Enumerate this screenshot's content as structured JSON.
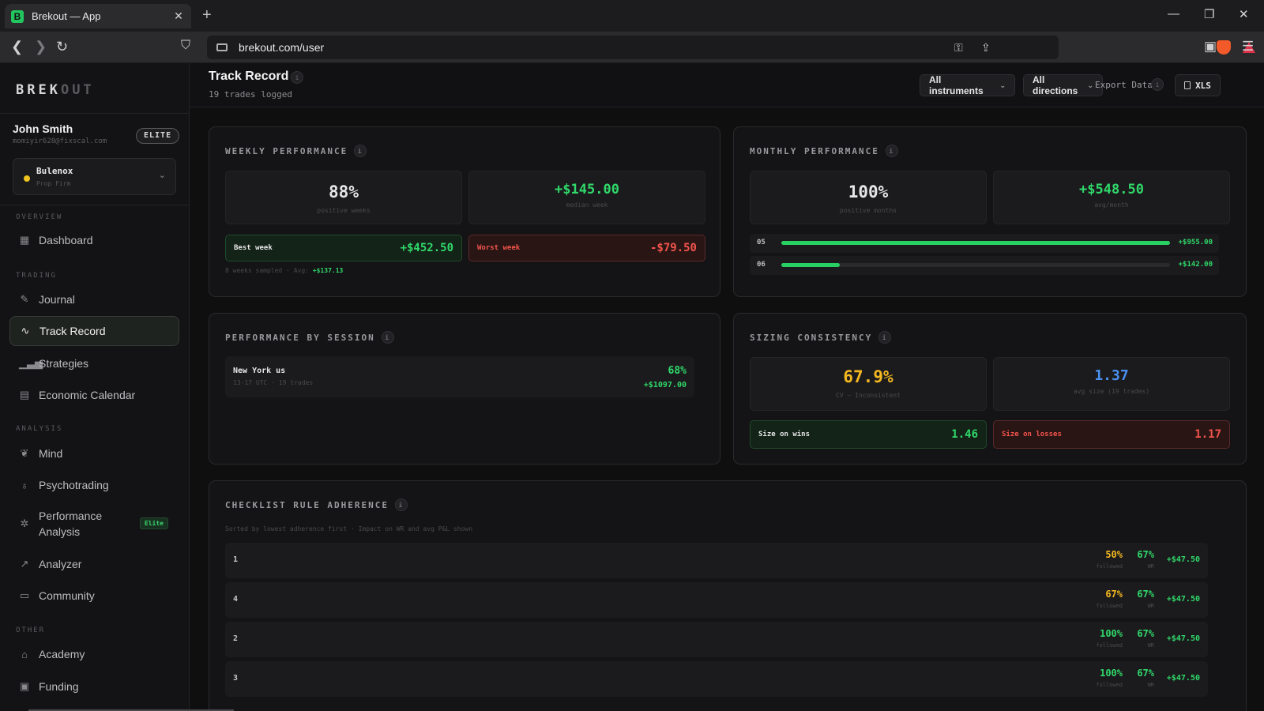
{
  "browser": {
    "tab_title": "Brekout — App",
    "tab_favicon": "B",
    "url": "brekout.com/user"
  },
  "sidebar": {
    "logo_bright": "BREK",
    "logo_dim": "OUT",
    "user": {
      "name": "John Smith",
      "email": "momiyir628@fixscal.com",
      "badge": "ELITE"
    },
    "firm": {
      "name": "Bulenox",
      "type": "Prop Firm",
      "status_color": "#f0c420"
    },
    "sections": {
      "overview": "OVERVIEW",
      "trading": "TRADING",
      "analysis": "ANALYSIS",
      "other": "OTHER"
    },
    "items": {
      "dashboard": {
        "label": "Dashboard",
        "icon": "grid-icon"
      },
      "journal": {
        "label": "Journal",
        "icon": "pencil-icon"
      },
      "track_record": {
        "label": "Track Record",
        "icon": "activity-icon",
        "active": true
      },
      "strategies": {
        "label": "Strategies",
        "icon": "bars-icon"
      },
      "economic_calendar": {
        "label": "Economic Calendar",
        "icon": "calendar-icon"
      },
      "mind": {
        "label": "Mind",
        "icon": "brain-icon"
      },
      "psychotrading": {
        "label": "Psychotrading",
        "icon": "bulb-icon"
      },
      "performance_analysis": {
        "label": "Performance Analysis",
        "icon": "sun-icon",
        "badge": "Elite"
      },
      "analyzer": {
        "label": "Analyzer",
        "icon": "trend-icon"
      },
      "community": {
        "label": "Community",
        "icon": "chat-icon"
      },
      "academy": {
        "label": "Academy",
        "icon": "cap-icon"
      },
      "funding": {
        "label": "Funding",
        "icon": "briefcase-icon"
      }
    }
  },
  "header": {
    "title": "Track Record",
    "subtitle": "19 trades logged",
    "filter_instruments": "All instruments",
    "filter_directions": "All directions",
    "export_label": "Export Data",
    "xls_label": "XLS"
  },
  "weekly": {
    "title": "WEEKLY PERFORMANCE",
    "positive_value": "88%",
    "positive_label": "positive weeks",
    "median_value": "+$145.00",
    "median_label": "median week",
    "best_label": "Best week",
    "best_value": "+$452.50",
    "worst_label": "Worst week",
    "worst_value": "-$79.50",
    "footer_text": "8 weeks sampled · Avg:",
    "footer_avg": "+$137.13"
  },
  "monthly": {
    "title": "MONTHLY PERFORMANCE",
    "positive_value": "100%",
    "positive_label": "positive months",
    "avg_value": "+$548.50",
    "avg_label": "avg/month",
    "rows": [
      {
        "month": "05",
        "value": "+$955.00",
        "fill_fraction": 1.0
      },
      {
        "month": "06",
        "value": "+$142.00",
        "fill_fraction": 0.15
      }
    ]
  },
  "session": {
    "title": "PERFORMANCE BY SESSION",
    "name": "New York us",
    "sub": "13-17 UTC · 19 trades",
    "winrate": "68%",
    "pnl": "+$1097.00"
  },
  "sizing": {
    "title": "SIZING CONSISTENCY",
    "cv_value": "67.9%",
    "cv_label": "CV — Inconsistent",
    "avg_value": "1.37",
    "avg_label": "avg size (19 trades)",
    "wins_label": "Size on wins",
    "wins_value": "1.46",
    "losses_label": "Size on losses",
    "losses_value": "1.17"
  },
  "checklist": {
    "title": "CHECKLIST RULE ADHERENCE",
    "subtitle": "Sorted by lowest adherence first · Impact on WR and avg P&L shown",
    "followed_label": "followed",
    "wr_label": "WR",
    "rows": [
      {
        "id": "1",
        "followed": "50%",
        "followed_color": "#f5b820",
        "wr": "67%",
        "pnl": "+$47.50"
      },
      {
        "id": "4",
        "followed": "67%",
        "followed_color": "#f5b820",
        "wr": "67%",
        "pnl": "+$47.50"
      },
      {
        "id": "2",
        "followed": "100%",
        "followed_color": "#30d86a",
        "wr": "67%",
        "pnl": "+$47.50"
      },
      {
        "id": "3",
        "followed": "100%",
        "followed_color": "#30d86a",
        "wr": "67%",
        "pnl": "+$47.50"
      }
    ]
  },
  "colors": {
    "positive": "#30d86a",
    "negative": "#f2544b",
    "warning": "#f5b820",
    "info": "#4a90f0"
  }
}
